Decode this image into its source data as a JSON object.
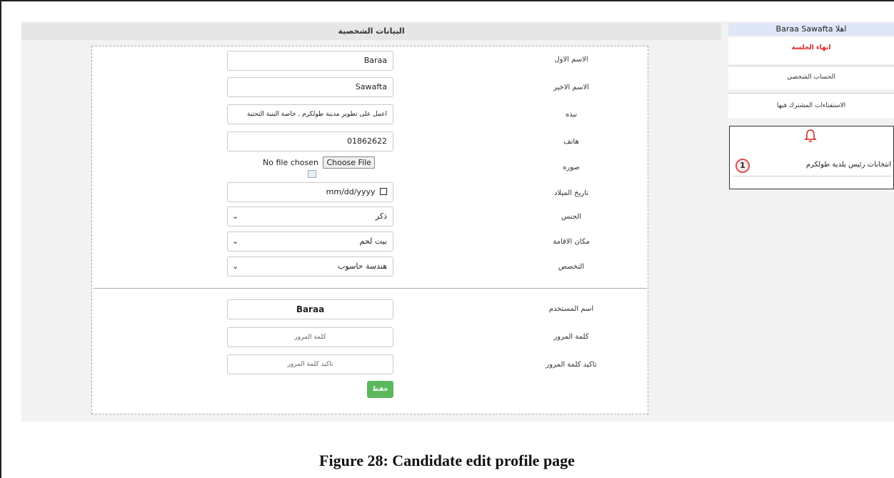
{
  "main": {
    "title": "البيانات الشخصية",
    "labels": {
      "first_name": "الاسم الاول",
      "last_name": "الاسم الاخير",
      "bio": "نبذه",
      "phone": "هاتف",
      "photo": "صوره",
      "birthdate": "تاريخ الميلاد",
      "gender": "الجنس",
      "residence": "مكان الاقامة",
      "major": "التخصص",
      "username": "اسم المستخدم",
      "password": "كلمة المرور",
      "confirm_password": "تاكيد كلمة المرور"
    },
    "values": {
      "first_name": "Baraa",
      "last_name": "Sawafta",
      "bio": "اعمل على تطوير مدينة طولكرم , خاصة البنية التحتية",
      "phone": "01862622",
      "file_status": "No file chosen",
      "file_button": "Choose File",
      "birthdate": "mm/dd/yyyy",
      "gender": "ذكر",
      "residence": "بيت لحم",
      "major": "هندسة حاسوب",
      "username": "Baraa"
    },
    "placeholders": {
      "password": "كلمة المرور",
      "confirm_password": "تاكيد كلمة المرور"
    },
    "save_label": "حفظ"
  },
  "sidebar": {
    "greeting": "اهلا Baraa Sawafta",
    "logout": "انهاء الجلسة",
    "profile": "الحساب الشخصي",
    "polls": "الاستفتاءات المشترك فيها",
    "notification_text": "انتخابات رئيس بلدية طولكرم",
    "notification_count": "1"
  },
  "caption": "Figure 28: Candidate edit profile page",
  "colors": {
    "save_button": "#5cb85c",
    "logout_text": "#d9231d",
    "bell": "#d9231d",
    "sidebar_header": "#dfe6f7"
  }
}
